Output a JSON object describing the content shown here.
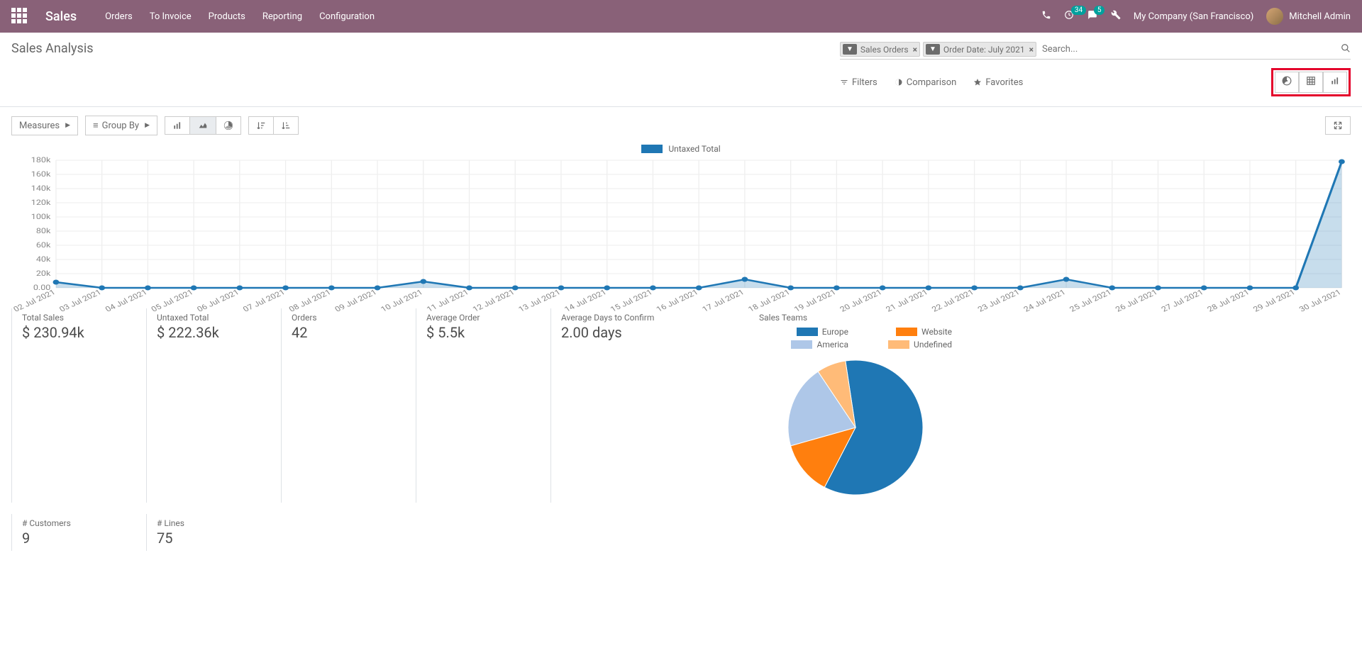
{
  "topbar": {
    "brand": "Sales",
    "menu": [
      "Orders",
      "To Invoice",
      "Products",
      "Reporting",
      "Configuration"
    ],
    "badge1": "34",
    "badge2": "5",
    "company": "My Company (San Francisco)",
    "user": "Mitchell Admin"
  },
  "page": {
    "title": "Sales Analysis",
    "search_placeholder": "Search...",
    "filter_chips": [
      {
        "label": "Sales Orders"
      },
      {
        "label": "Order Date: July 2021"
      }
    ],
    "toolbar": {
      "filters": "Filters",
      "comparison": "Comparison",
      "favorites": "Favorites"
    }
  },
  "controls": {
    "measures": "Measures",
    "group_by": "Group By"
  },
  "legend": {
    "series1": "Untaxed Total"
  },
  "stats": {
    "total_sales_label": "Total Sales",
    "total_sales_value": "$ 230.94k",
    "untaxed_total_label": "Untaxed Total",
    "untaxed_total_value": "$ 222.36k",
    "orders_label": "Orders",
    "orders_value": "42",
    "avg_order_label": "Average Order",
    "avg_order_value": "$ 5.5k",
    "avg_days_label": "Average Days to Confirm",
    "avg_days_value": "2.00 days",
    "customers_label": "# Customers",
    "customers_value": "9",
    "lines_label": "# Lines",
    "lines_value": "75"
  },
  "pie": {
    "title": "Sales Teams",
    "legend": {
      "a": "Europe",
      "b": "Website",
      "c": "America",
      "d": "Undefined"
    }
  },
  "chart_data": [
    {
      "type": "area",
      "title": "Untaxed Total",
      "ylabel": "",
      "xlabel": "",
      "ylim": [
        0,
        180000
      ],
      "yticks": [
        "0.00",
        "20k",
        "40k",
        "60k",
        "80k",
        "100k",
        "120k",
        "140k",
        "160k",
        "180k"
      ],
      "categories": [
        "02 Jul 2021",
        "03 Jul 2021",
        "04 Jul 2021",
        "05 Jul 2021",
        "06 Jul 2021",
        "07 Jul 2021",
        "08 Jul 2021",
        "09 Jul 2021",
        "10 Jul 2021",
        "11 Jul 2021",
        "12 Jul 2021",
        "13 Jul 2021",
        "14 Jul 2021",
        "15 Jul 2021",
        "16 Jul 2021",
        "17 Jul 2021",
        "18 Jul 2021",
        "19 Jul 2021",
        "20 Jul 2021",
        "21 Jul 2021",
        "22 Jul 2021",
        "23 Jul 2021",
        "24 Jul 2021",
        "25 Jul 2021",
        "26 Jul 2021",
        "27 Jul 2021",
        "28 Jul 2021",
        "29 Jul 2021",
        "30 Jul 2021"
      ],
      "series": [
        {
          "name": "Untaxed Total",
          "values": [
            8000,
            0,
            0,
            0,
            0,
            0,
            0,
            0,
            9000,
            0,
            0,
            0,
            0,
            0,
            0,
            12000,
            0,
            0,
            0,
            0,
            0,
            0,
            12000,
            0,
            0,
            0,
            0,
            0,
            178000
          ]
        }
      ]
    },
    {
      "type": "pie",
      "title": "Sales Teams",
      "series": [
        {
          "name": "Europe",
          "value": 60,
          "color": "#1f77b4"
        },
        {
          "name": "Website",
          "value": 13,
          "color": "#ff7f0e"
        },
        {
          "name": "America",
          "value": 20,
          "color": "#aec7e8"
        },
        {
          "name": "Undefined",
          "value": 7,
          "color": "#ffbb78"
        }
      ]
    }
  ]
}
